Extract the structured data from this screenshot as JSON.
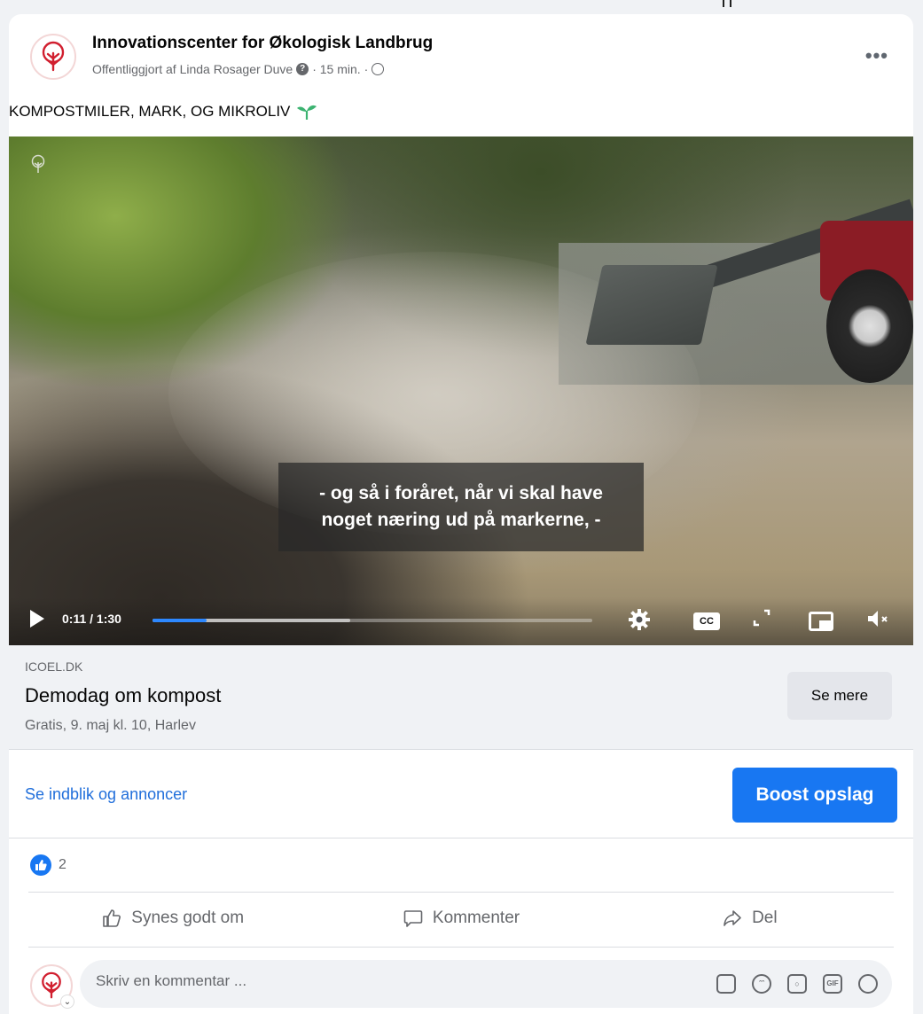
{
  "post": {
    "page_name": "Innovationscenter for Økologisk Landbrug",
    "byline_prefix": "Offentliggjort af Linda Rosager Duve",
    "time": "· 15 min. ·",
    "text": "KOMPOSTMILER, MARK, OG MIKROLIV",
    "more": "•••"
  },
  "video": {
    "watermark": "Innovationscenter for Økologisk Landbrug",
    "subtitle_line1": "- og så i foråret, når vi skal have",
    "subtitle_line2": "noget næring ud på markerne, -",
    "time": "0:11 / 1:30",
    "played_fraction": 0.122,
    "buffered_fraction": 0.45,
    "cc_label": "CC"
  },
  "link": {
    "domain": "ICOEL.DK",
    "title": "Demodag om kompost",
    "description": "Gratis, 9. maj kl. 10, Harlev",
    "button": "Se mere"
  },
  "insights": {
    "link": "Se indblik og annoncer",
    "boost": "Boost opslag"
  },
  "reactions": {
    "count": "2"
  },
  "actions": {
    "like": "Synes godt om",
    "comment": "Kommenter",
    "share": "Del"
  },
  "comment": {
    "placeholder": "Skriv en kommentar ...",
    "gif_label": "GIF"
  },
  "colors": {
    "accent": "#1877f2",
    "link": "#216fdb",
    "brand_red": "#d11f2f",
    "sprout": "#3cb371"
  }
}
